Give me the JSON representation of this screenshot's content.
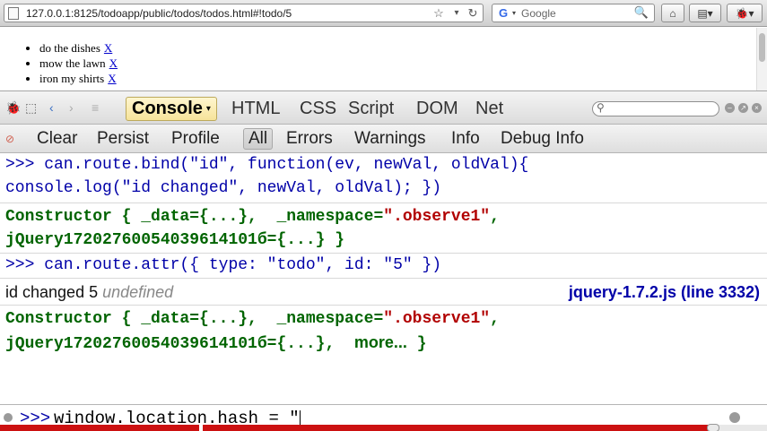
{
  "browser": {
    "url": "127.0.0.1:8125/todoapp/public/todos/todos.html#!todo/5",
    "search_placeholder": "Google",
    "star_glyph": "☆",
    "dropdown_glyph": "▾",
    "reload_glyph": "↻",
    "search_glyph": "🔍",
    "home_glyph": "⌂",
    "bookmark_glyph": "▤▾",
    "firebug_glyph": "🐞▾"
  },
  "page": {
    "todos": [
      {
        "text": "do the dishes",
        "delete_label": "X"
      },
      {
        "text": "mow the lawn",
        "delete_label": "X"
      },
      {
        "text": "iron my shirts",
        "delete_label": "X"
      }
    ]
  },
  "firebug": {
    "tabs": [
      {
        "label": "Console",
        "active": true
      },
      {
        "label": "HTML"
      },
      {
        "label": "CSS"
      },
      {
        "label": "Script"
      },
      {
        "label": "DOM"
      },
      {
        "label": "Net"
      }
    ],
    "console_caret": "▾",
    "sub_buttons": [
      {
        "label": "Clear"
      },
      {
        "label": "Persist"
      },
      {
        "label": "Profile"
      }
    ],
    "filters": [
      {
        "label": "All",
        "active": true
      },
      {
        "label": "Errors"
      },
      {
        "label": "Warnings"
      },
      {
        "label": "Info"
      },
      {
        "label": "Debug Info"
      }
    ]
  },
  "console": {
    "entries": {
      "cmd1_line1": ">>> can.route.bind(\"id\", function(ev, newVal, oldVal){",
      "cmd1_line2": "console.log(\"id changed\", newVal, oldVal); })",
      "obj1_prefix": "Constructor { _data={...},  _namespace=",
      "obj1_string": "\".observe1\"",
      "obj1_suffix": ",",
      "obj1_line2": "jQuery17202760054039614101б={...} }",
      "cmd2": ">>> can.route.attr({ type: \"todo\", id: \"5\" })",
      "info_text": "id changed 5 ",
      "info_undef": "undefined",
      "info_source": "jquery-1.7.2.js (line 3332)",
      "obj2_prefix": "Constructor { _data={...},  _namespace=",
      "obj2_string": "\".observe1\"",
      "obj2_suffix": ",",
      "obj2_line2": "jQuery17202760054039614101б={...},  ",
      "obj2_more": "more...",
      "obj2_close": " }"
    },
    "prompt": ">>>",
    "command_input": "window.location.hash = \""
  },
  "progress": {
    "fraction": 0.93
  },
  "colors": {
    "command": "#0000a8",
    "object": "#006400",
    "string": "#b10000",
    "active_tab": "#f6e39a",
    "progress": "#cc1111"
  }
}
